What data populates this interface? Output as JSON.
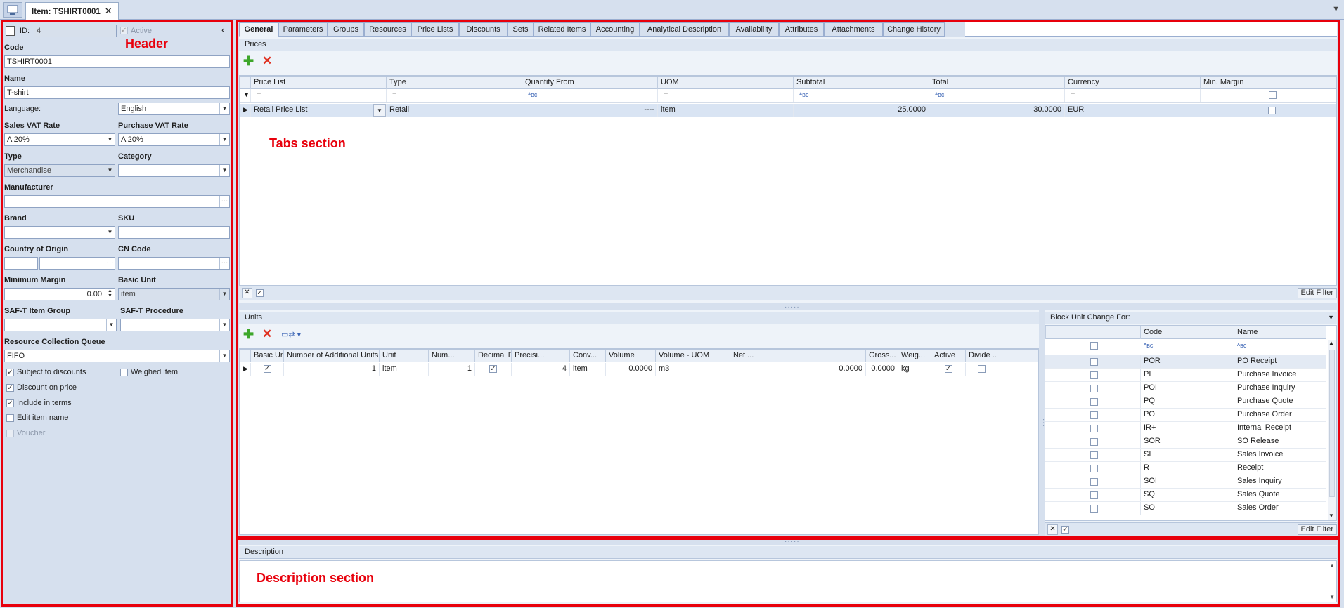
{
  "window": {
    "doc_tab_title": "Item: TSHIRT0001",
    "close_glyph": "✕"
  },
  "annotations": {
    "header": "Header",
    "tabs": "Tabs section",
    "description": "Description section"
  },
  "header": {
    "id_label": "ID:",
    "id_value": "4",
    "active_label": "Active",
    "collapse_glyph": "‹",
    "code_label": "Code",
    "code_value": "TSHIRT0001",
    "name_label": "Name",
    "name_value": "T-shirt",
    "language_label": "Language:",
    "language_value": "English",
    "sales_vat_label": "Sales VAT Rate",
    "sales_vat_value": "A 20%",
    "purchase_vat_label": "Purchase VAT Rate",
    "purchase_vat_value": "A 20%",
    "type_label": "Type",
    "type_value": "Merchandise",
    "category_label": "Category",
    "category_value": "",
    "manufacturer_label": "Manufacturer",
    "manufacturer_value": "",
    "brand_label": "Brand",
    "brand_value": "",
    "sku_label": "SKU",
    "sku_value": "",
    "country_label": "Country of Origin",
    "cn_label": "CN Code",
    "min_margin_label": "Minimum Margin",
    "min_margin_value": "0.00",
    "basic_unit_label": "Basic Unit",
    "basic_unit_value": "item",
    "saft_group_label": "SAF-T Item Group",
    "saft_proc_label": "SAF-T Procedure",
    "queue_label": "Resource Collection Queue",
    "queue_value": "FIFO",
    "subject_discounts": "Subject to discounts",
    "weighed_item": "Weighed item",
    "discount_on_price": "Discount on price",
    "include_terms": "Include in terms",
    "edit_item_name": "Edit item name",
    "voucher": "Voucher"
  },
  "tabs": [
    "General",
    "Parameters",
    "Groups",
    "Resources",
    "Price Lists",
    "Discounts",
    "Sets",
    "Related Items",
    "Accounting",
    "Analytical Description",
    "Availability",
    "Attributes",
    "Attachments",
    "Change History"
  ],
  "prices": {
    "title": "Prices",
    "columns": [
      "Price List",
      "Type",
      "Quantity From",
      "UOM",
      "Subtotal",
      "Total",
      "Currency",
      "Min. Margin"
    ],
    "filter_eq": "=",
    "filter_abc": "ᴬʙᴄ",
    "row": {
      "price_list": "Retail Price List",
      "type": "Retail",
      "quantity_from": "----",
      "uom": "item",
      "subtotal": "25.0000",
      "total": "30.0000",
      "currency": "EUR"
    },
    "edit_filter": "Edit Filter"
  },
  "units": {
    "title": "Units",
    "columns": [
      "Basic Unit",
      "Number of Additional Units",
      "Unit",
      "Num...",
      "Decimal Form",
      "Precisi...",
      "Conv...",
      "Volume",
      "Volume - UOM",
      "Net ...",
      "Gross...",
      "Weig...",
      "Active",
      "Divide ..."
    ],
    "row": {
      "additional": "1",
      "unit": "item",
      "num": "1",
      "precision": "4",
      "conv": "item",
      "volume": "0.0000",
      "volume_uom": "m3",
      "net": "0.0000",
      "gross": "0.0000",
      "weight": "kg"
    }
  },
  "block": {
    "title": "Block Unit Change For:",
    "col_code": "Code",
    "col_name": "Name",
    "rows": [
      {
        "code": "POR",
        "name": "PO Receipt"
      },
      {
        "code": "PI",
        "name": "Purchase Invoice"
      },
      {
        "code": "POI",
        "name": "Purchase Inquiry"
      },
      {
        "code": "PQ",
        "name": "Purchase Quote"
      },
      {
        "code": "PO",
        "name": "Purchase Order"
      },
      {
        "code": "IR+",
        "name": "Internal Receipt"
      },
      {
        "code": "SOR",
        "name": "SO Release"
      },
      {
        "code": "SI",
        "name": "Sales Invoice"
      },
      {
        "code": "R",
        "name": "Receipt"
      },
      {
        "code": "SOI",
        "name": "Sales Inquiry"
      },
      {
        "code": "SQ",
        "name": "Sales Quote"
      },
      {
        "code": "SO",
        "name": "Sales Order"
      }
    ],
    "edit_filter": "Edit Filter"
  },
  "description": {
    "title": "Description"
  },
  "colors": {
    "accent_red": "#e8000c",
    "panel": "#d6e0ee",
    "header_bg": "#dde6f2"
  }
}
